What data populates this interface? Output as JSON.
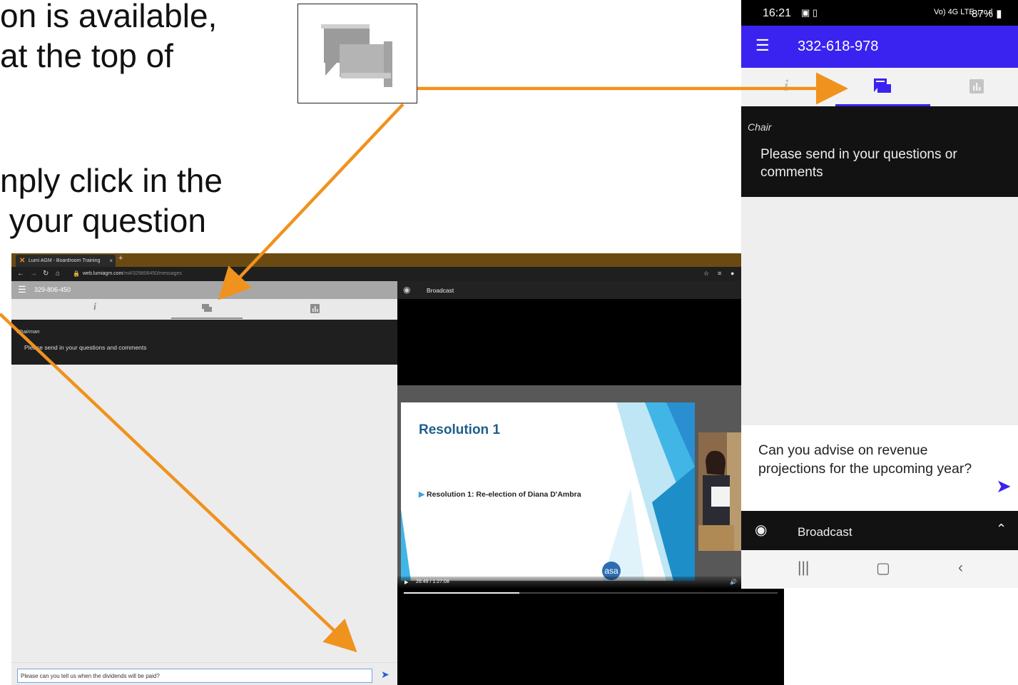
{
  "instructions": {
    "line1": "on is available,",
    "line2": "at the top of",
    "line3": "nply click in the",
    "line4": " your question"
  },
  "desktop": {
    "browser_tab": "Lumi AGM - Boardroom Training",
    "tab_close": "×",
    "new_tab": "+",
    "url_host": "web.lumiagm.com",
    "url_path": "/m#/329806450/messages",
    "meeting_id": "329-806-450",
    "sender": "Chairman",
    "message": "Please send in your questions and comments",
    "input_value": "Please can you tell us when the dividends will be paid?",
    "broadcast_label": "Broadcast",
    "video_time": "26:49 / 1:27:08",
    "video_progress_fraction": 0.31,
    "slide": {
      "title": "Resolution 1",
      "bullet": "Resolution 1: Re-election of Diana D'Ambra",
      "logo": "asa"
    }
  },
  "phone": {
    "time": "16:21",
    "network": "Vo) 4G LTE ↓↑ .ıl",
    "battery": "87%",
    "meeting_id": "332-618-978",
    "sender": "Chair",
    "message": "Please send in your questions or comments",
    "input_value": "Can you advise on revenue projections for the upcoming year?",
    "broadcast_label": "Broadcast"
  },
  "colors": {
    "arrow": "#f0921e",
    "phone_accent": "#3a23f0",
    "desktop_send": "#2a59d6",
    "lumi_header": "#a7a7a7"
  },
  "icons": {
    "info": "info-icon",
    "messaging": "messaging-icon",
    "polls": "poll-chart-icon",
    "broadcast": "broadcast-icon"
  }
}
